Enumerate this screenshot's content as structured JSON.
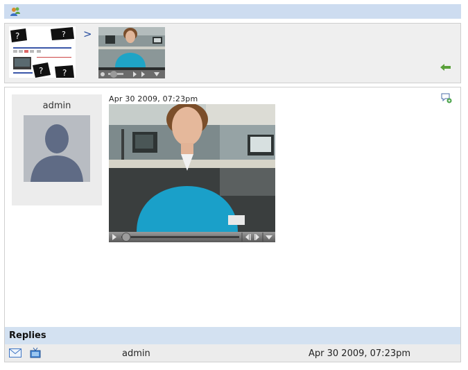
{
  "header": {
    "icon": "users-icon"
  },
  "breadcrumb": {
    "separator": ">",
    "back_icon": "back-arrow-icon"
  },
  "post": {
    "author": "admin",
    "timestamp": "Apr 30 2009, 07:23pm",
    "add_comment_icon": "add-comment-icon"
  },
  "replies": {
    "title": "Replies",
    "rows": [
      {
        "author": "admin",
        "timestamp": "Apr 30 2009, 07:23pm",
        "icons": [
          "mail-icon",
          "video-icon"
        ]
      }
    ]
  },
  "colors": {
    "header_bar": "#cddcf0",
    "replies_bar": "#d3e1f1",
    "row_bg": "#ececec",
    "link_blue": "#2a4fa0"
  }
}
